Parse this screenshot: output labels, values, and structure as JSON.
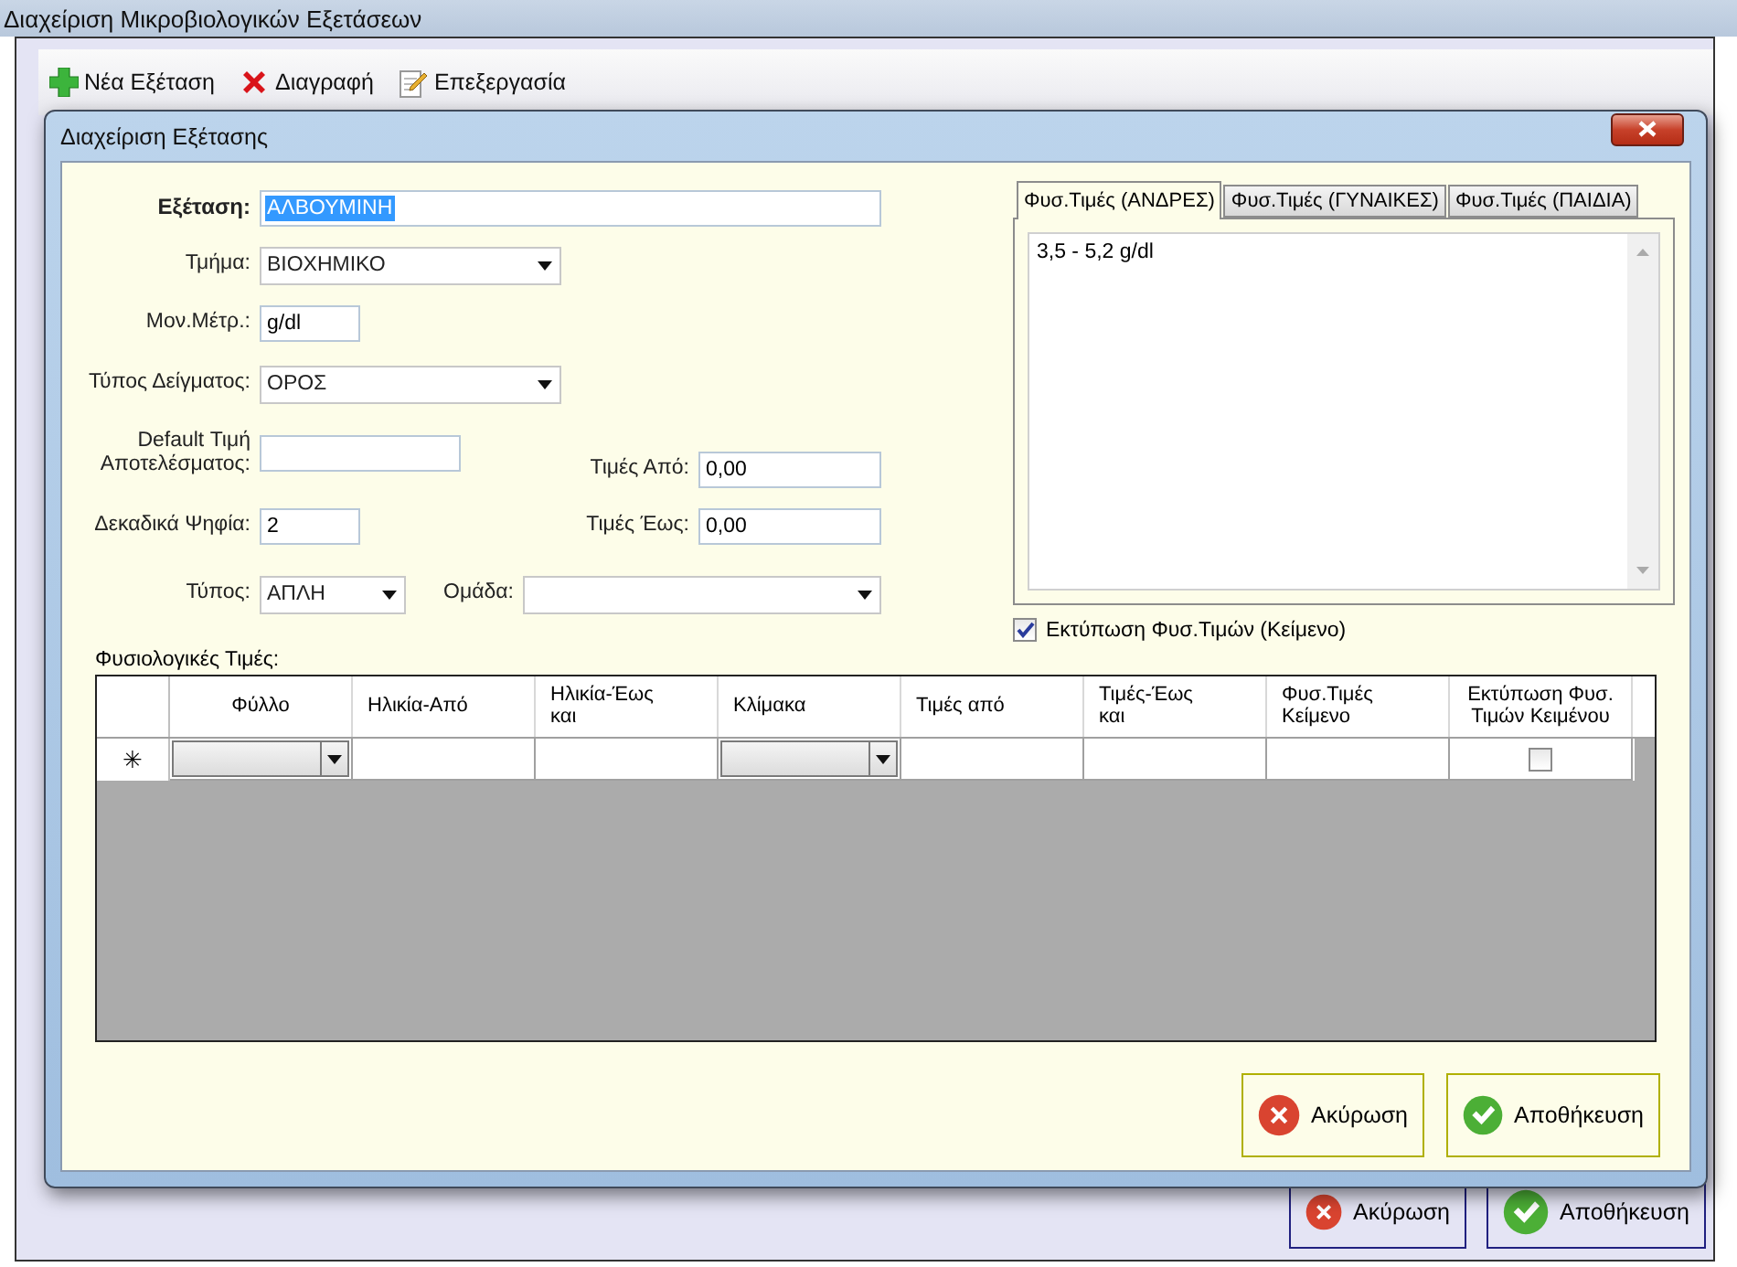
{
  "window": {
    "title": "Διαχείριση Μικροβιολογικών Εξετάσεων"
  },
  "toolbar": [
    {
      "label": "Νέα Εξέταση",
      "kind": "add"
    },
    {
      "label": "Διαγραφή",
      "kind": "delete"
    },
    {
      "label": "Επεξεργασία",
      "kind": "edit"
    }
  ],
  "dialog": {
    "title": "Διαχείριση Εξέτασης",
    "form_rows": [
      [
        {
          "label": "Εξέταση:",
          "kind": "title",
          "value": "ΑΛΒΟΥΜΙΝΗ",
          "text_selected": true
        }
      ],
      [
        {
          "label": "Τμήμα:",
          "kind": "combo",
          "value": "ΒΙΟΧΗΜΙΚΟ"
        }
      ],
      [
        {
          "label": "Μον.Μέτρ.:",
          "kind": "short",
          "value": "g/dl"
        }
      ],
      [
        {
          "label": "Τύπος Δείγματος:",
          "kind": "combo",
          "value": "ΟΡΟΣ"
        }
      ],
      [
        {
          "label": "Default Τιμή Αποτελέσματος:",
          "kind": "medium"
        },
        {
          "label": "Τιμές Από:",
          "kind": "right",
          "value": "0,00"
        }
      ],
      [
        {
          "label": "Δεκαδικά Ψηφία:",
          "kind": "short",
          "value": "2"
        },
        {
          "label": "Τιμές Έως:",
          "kind": "right",
          "value": "0,00"
        }
      ],
      [
        {
          "label": "Τύπος:",
          "kind": "smallcombo",
          "value": "ΑΠΛΗ"
        },
        {
          "label": "Ομάδα:",
          "kind": "widecombo"
        }
      ]
    ],
    "tabs": [
      {
        "label": "Φυσ.Τιμές (ΑΝΔΡΕΣ)",
        "selected": true
      },
      {
        "label": "Φυσ.Τιμές (ΓΥΝΑΙΚΕΣ)",
        "selected": false
      },
      {
        "label": "Φυσ.Τιμές (ΠΑΙΔΙΑ)",
        "selected": false
      }
    ],
    "tab_text": "3,5 - 5,2 g/dl",
    "print_checkbox": {
      "label": "Εκτύπωση Φυσ.Τιμών (Κείμενο)",
      "checked": true
    },
    "grid_label": "Φυσιολογικές Τιμές:",
    "grid": {
      "new_row_marker": "✳",
      "columns": [
        {
          "header": "Φύλλο",
          "kind": "combo"
        },
        {
          "header": "Ηλικία-Από",
          "kind": "text"
        },
        {
          "header": "Ηλικία-Έως\nκαι",
          "kind": "text"
        },
        {
          "header": "Κλίμακα",
          "kind": "combo"
        },
        {
          "header": "Τιμές από",
          "kind": "text"
        },
        {
          "header": "Τιμές-Έως\nκαι",
          "kind": "text"
        },
        {
          "header": "Φυσ.Τιμές\nΚείμενο",
          "kind": "text"
        },
        {
          "header": "Εκτύπωση Φυσ.\nΤιμών Κειμένου",
          "kind": "checkbox",
          "checked": false
        }
      ]
    },
    "buttons": [
      {
        "label": "Ακύρωση",
        "kind": "cancel"
      },
      {
        "label": "Αποθήκευση",
        "kind": "save"
      }
    ]
  },
  "footer_buttons": [
    {
      "label": "Ακύρωση",
      "kind": "cancel"
    },
    {
      "label": "Αποθήκευση",
      "kind": "save"
    }
  ]
}
